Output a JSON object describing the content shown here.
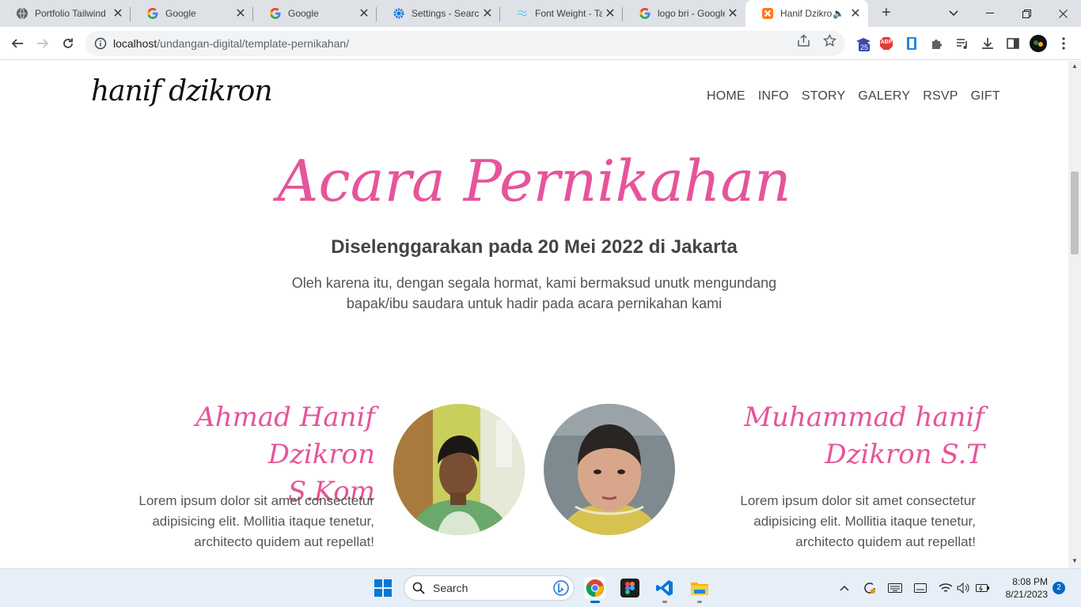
{
  "browser": {
    "tabs": [
      {
        "title": "Portfolio Tailwind",
        "icon": "globe-icon"
      },
      {
        "title": "Google",
        "icon": "google-icon"
      },
      {
        "title": "Google",
        "icon": "google-icon"
      },
      {
        "title": "Settings - Search",
        "icon": "gear-icon"
      },
      {
        "title": "Font Weight - Tai",
        "icon": "tailwind-icon"
      },
      {
        "title": "logo bri - Google",
        "icon": "google-icon"
      },
      {
        "title": "Hanif Dzikron",
        "icon": "xampp-icon",
        "active": true,
        "audio": true
      }
    ],
    "url_host": "localhost",
    "url_path": "/undangan-digital/template-pernikahan/",
    "extension_badge": "25",
    "abp_label": "ABP"
  },
  "site": {
    "logo": "hanif dzikron",
    "menu": [
      "HOME",
      "INFO",
      "STORY",
      "GALERY",
      "RSVP",
      "GIFT"
    ]
  },
  "hero": {
    "title": "Acara Pernikahan",
    "subtitle": "Diselenggarakan pada 20 Mei 2022 di Jakarta",
    "description": "Oleh karena itu, dengan segala hormat, kami bermaksud unutk mengundang bapak/ibu saudara untuk hadir pada acara pernikahan kami"
  },
  "couple": {
    "left": {
      "name_line1": "Ahmad Hanif Dzikron",
      "name_line2": "S.Kom",
      "desc": "Lorem ipsum dolor sit amet consectetur adipisicing elit. Mollitia itaque tenetur, architecto quidem aut repellat!"
    },
    "right": {
      "name_line1": "Muhammad hanif",
      "name_line2": "Dzikron S.T",
      "desc": "Lorem ipsum dolor sit amet consectetur adipisicing elit. Mollitia itaque tenetur, architecto quidem aut repellat!"
    }
  },
  "taskbar": {
    "search_placeholder": "Search",
    "time": "8:08 PM",
    "date": "8/21/2023",
    "notification_count": "2"
  }
}
